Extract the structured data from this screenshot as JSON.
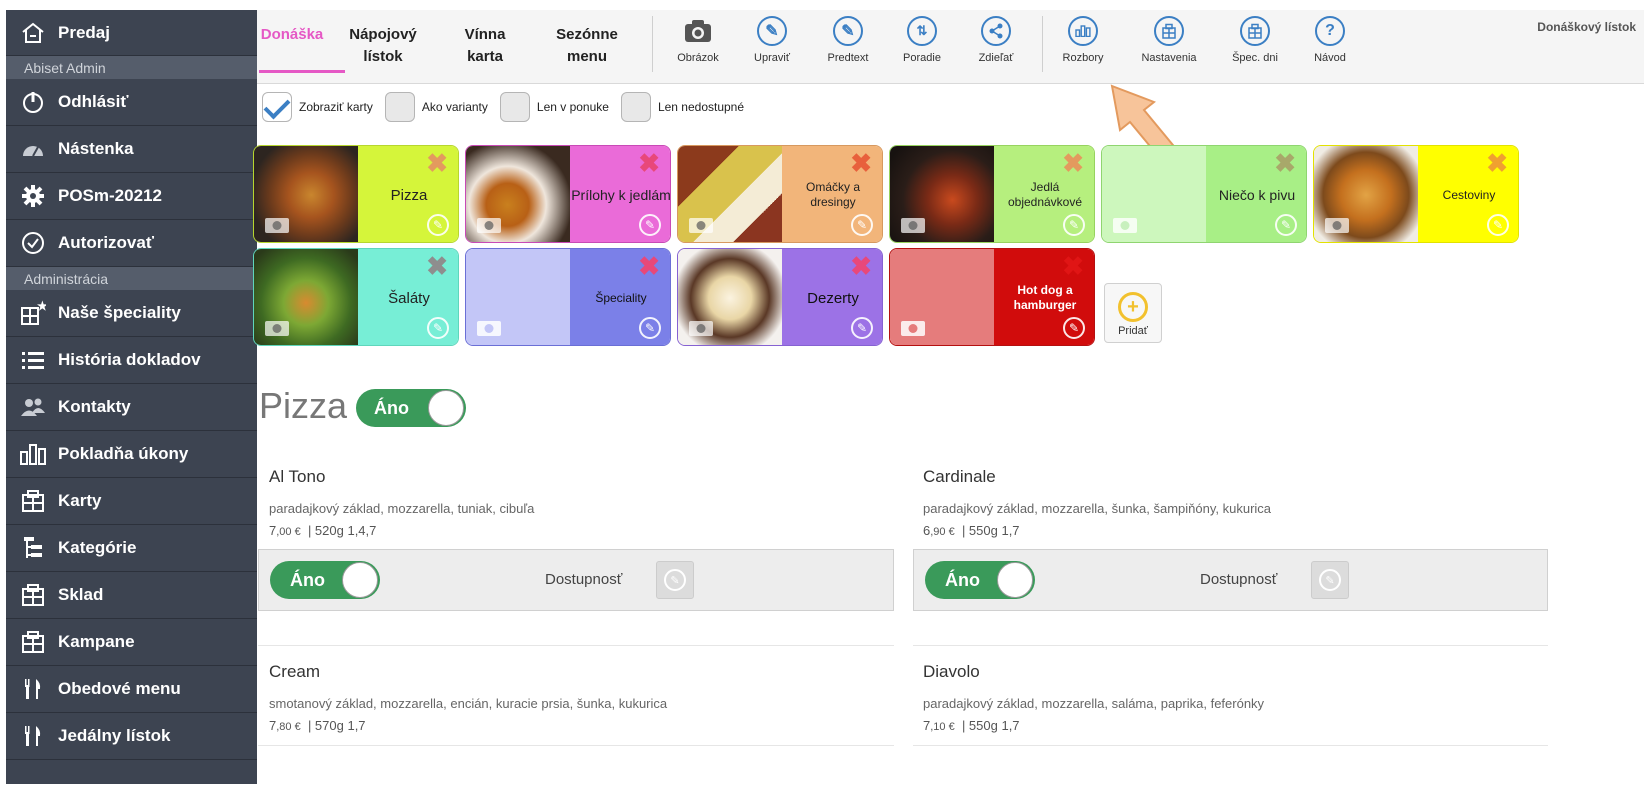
{
  "sidebar": {
    "items": [
      {
        "label": "Predaj",
        "icon": "home-icon"
      },
      {
        "section": "Abiset Admin"
      },
      {
        "label": "Odhlásiť",
        "icon": "power-icon"
      },
      {
        "label": "Nástenka",
        "icon": "dashboard-icon"
      },
      {
        "label": "POSm-20212",
        "icon": "gear-icon"
      },
      {
        "label": "Autorizovať",
        "icon": "check-circle-icon"
      },
      {
        "section": "Administrácia"
      },
      {
        "label": "Naše špeciality",
        "icon": "grid-star-icon"
      },
      {
        "label": "História dokladov",
        "icon": "list-icon"
      },
      {
        "label": "Kontakty",
        "icon": "users-icon"
      },
      {
        "label": "Pokladňa úkony",
        "icon": "bars-icon"
      },
      {
        "label": "Karty",
        "icon": "grid-icon"
      },
      {
        "label": "Kategórie",
        "icon": "tree-icon"
      },
      {
        "label": "Sklad",
        "icon": "grid-icon"
      },
      {
        "label": "Kampane",
        "icon": "grid-icon"
      },
      {
        "label": "Obedové menu",
        "icon": "cutlery-icon"
      },
      {
        "label": "Jedálny lístok",
        "icon": "cutlery-icon"
      }
    ]
  },
  "toolbar": {
    "tabs": [
      "Donáška",
      "Nápojový lístok",
      "Vínna karta",
      "Sezónne menu"
    ],
    "tools": [
      {
        "label": "Obrázok",
        "icon": "camera-icon"
      },
      {
        "label": "Upraviť",
        "icon": "pencil-icon"
      },
      {
        "label": "Predtext",
        "icon": "pencil-icon"
      },
      {
        "label": "Poradie",
        "icon": "sort-icon"
      },
      {
        "label": "Zdieľať",
        "icon": "share-icon"
      },
      {
        "label": "Rozbory",
        "icon": "chart-icon"
      },
      {
        "label": "Nastavenia",
        "icon": "grid-icon"
      },
      {
        "label": "Špec. dni",
        "icon": "grid-icon"
      },
      {
        "label": "Návod",
        "icon": "help-icon"
      }
    ],
    "right_label": "Donáškový lístok"
  },
  "filters": [
    {
      "label": "Zobraziť karty",
      "checked": true
    },
    {
      "label": "Ako varianty",
      "checked": false
    },
    {
      "label": "Len v ponuke",
      "checked": false
    },
    {
      "label": "Len nedostupné",
      "checked": false
    }
  ],
  "categories": [
    {
      "label": "Pizza",
      "color": "#d5f53a"
    },
    {
      "label": "Prílohy k jedlám",
      "color": "#ea6bd8"
    },
    {
      "label": "Omáčky a dresingy",
      "color": "#f2b57a"
    },
    {
      "label": "Jedlá objednávkové",
      "color": "#b6ef7e"
    },
    {
      "label": "Niečo k pivu",
      "color": "#a8ef86"
    },
    {
      "label": "Cestoviny",
      "color": "#ffff00"
    },
    {
      "label": "Šaláty",
      "color": "#77eed6"
    },
    {
      "label": "Špeciality",
      "color": "#7b80e8"
    },
    {
      "label": "Dezerty",
      "color": "#9c72e6"
    },
    {
      "label": "Hot dog a hamburger",
      "color": "#d10c0c"
    }
  ],
  "add_label": "Pridať",
  "section": {
    "title": "Pizza",
    "toggle": "Áno"
  },
  "products": [
    {
      "name": "Al Tono",
      "desc": "paradajkový základ, mozzarella, tuniak, cibuľa",
      "price_main": "7",
      "price_dec": ",00 €",
      "meta": "|  520g  1,4,7",
      "toggle": "Áno",
      "avail": "Dostupnosť"
    },
    {
      "name": "Cardinale",
      "desc": "paradajkový základ, mozzarella, šunka, šampiňóny, kukurica",
      "price_main": "6",
      "price_dec": ",90 €",
      "meta": "|  550g  1,7",
      "toggle": "Áno",
      "avail": "Dostupnosť"
    },
    {
      "name": "Cream",
      "desc": "smotanový základ, mozzarella, encián, kuracie prsia, šunka, kukurica",
      "price_main": "7",
      "price_dec": ",80 €",
      "meta": "|  570g  1,7"
    },
    {
      "name": "Diavolo",
      "desc": "paradajkový základ, mozzarella, saláma, paprika, feferónky",
      "price_main": "7",
      "price_dec": ",10 €",
      "meta": "|  550g  1,7"
    }
  ]
}
